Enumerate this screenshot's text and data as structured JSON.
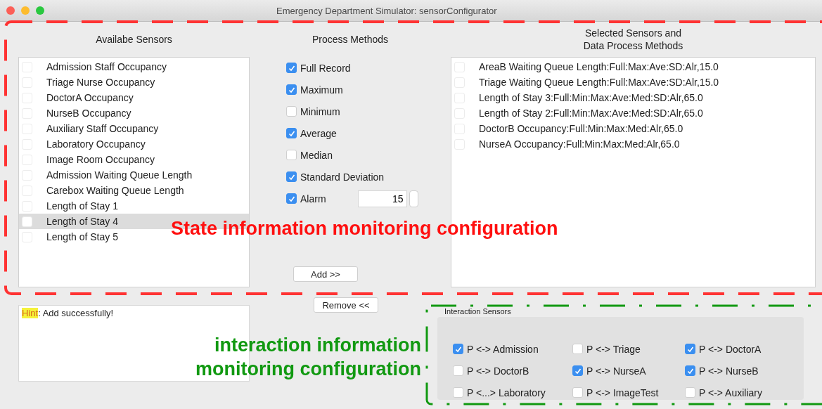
{
  "window": {
    "title": "Emergency Department Simulator: sensorConfigurator"
  },
  "available_sensors": {
    "heading": "Availabe Sensors",
    "items": [
      {
        "label": "Admission Staff Occupancy",
        "checked": false,
        "selected": false
      },
      {
        "label": "Triage Nurse Occupancy",
        "checked": false,
        "selected": false
      },
      {
        "label": "DoctorA Occupancy",
        "checked": false,
        "selected": false
      },
      {
        "label": "NurseB Occupancy",
        "checked": false,
        "selected": false
      },
      {
        "label": "Auxiliary Staff Occupancy",
        "checked": false,
        "selected": false
      },
      {
        "label": "Laboratory Occupancy",
        "checked": false,
        "selected": false
      },
      {
        "label": "Image Room Occupancy",
        "checked": false,
        "selected": false
      },
      {
        "label": "Admission Waiting Queue Length",
        "checked": false,
        "selected": false
      },
      {
        "label": "Carebox Waiting Queue Length",
        "checked": false,
        "selected": false
      },
      {
        "label": "Length of Stay 1",
        "checked": false,
        "selected": false
      },
      {
        "label": "Length of Stay 4",
        "checked": false,
        "selected": true
      },
      {
        "label": "Length of Stay 5",
        "checked": false,
        "selected": false
      }
    ]
  },
  "process_methods": {
    "heading": "Process Methods",
    "options": [
      {
        "label": "Full Record",
        "checked": true
      },
      {
        "label": "Maximum",
        "checked": true
      },
      {
        "label": "Minimum",
        "checked": false
      },
      {
        "label": "Average",
        "checked": true
      },
      {
        "label": "Median",
        "checked": false
      },
      {
        "label": "Standard Deviation",
        "checked": true
      }
    ],
    "alarm": {
      "label": "Alarm",
      "checked": true,
      "value": "15"
    },
    "add_button": "Add >>",
    "remove_button": "Remove <<"
  },
  "selected_sensors": {
    "heading": "Selected Sensors and\n Data Process Methods",
    "items": [
      {
        "label": "AreaB Waiting Queue Length:Full:Max:Ave:SD:Alr,15.0",
        "checked": false
      },
      {
        "label": "Triage Waiting Queue Length:Full:Max:Ave:SD:Alr,15.0",
        "checked": false
      },
      {
        "label": "Length of Stay 3:Full:Min:Max:Ave:Med:SD:Alr,65.0",
        "checked": false
      },
      {
        "label": "Length of Stay 2:Full:Min:Max:Ave:Med:SD:Alr,65.0",
        "checked": false
      },
      {
        "label": "DoctorB Occupancy:Full:Min:Max:Med:Alr,65.0",
        "checked": false
      },
      {
        "label": "NurseA Occupancy:Full:Min:Max:Med:Alr,65.0",
        "checked": false
      }
    ]
  },
  "hint": {
    "label": "Hint",
    "message": ": Add successfully!"
  },
  "interaction_sensors": {
    "title": "Interaction Sensors",
    "items": [
      {
        "label": "P <-> Admission",
        "checked": true
      },
      {
        "label": "P <-> Triage",
        "checked": false
      },
      {
        "label": "P <-> DoctorA",
        "checked": true
      },
      {
        "label": "P <-> DoctorB",
        "checked": false
      },
      {
        "label": "P <-> NurseA",
        "checked": true
      },
      {
        "label": "P <-> NurseB",
        "checked": true
      },
      {
        "label": "P <...> Laboratory",
        "checked": false
      },
      {
        "label": "P <-> ImageTest",
        "checked": false
      },
      {
        "label": "P <-> Auxiliary",
        "checked": false
      }
    ]
  },
  "annotations": [
    {
      "kind": "state",
      "text": "State information monitoring configuration"
    },
    {
      "kind": "interaction",
      "text": "interaction information\nmonitoring configuration"
    }
  ]
}
